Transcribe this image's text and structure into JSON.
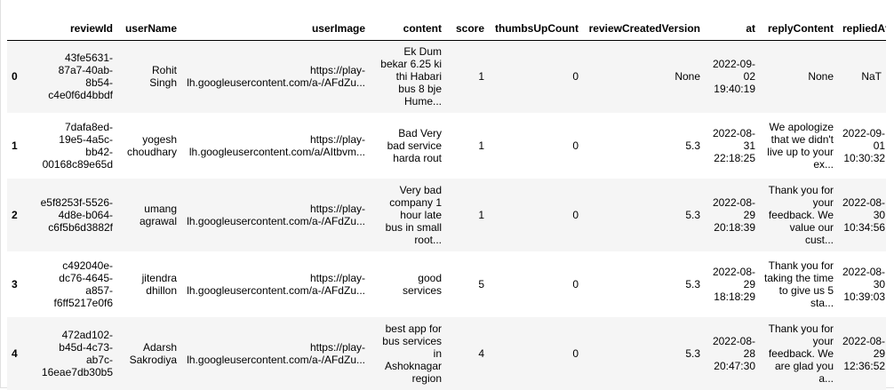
{
  "table": {
    "columns": [
      "",
      "reviewId",
      "userName",
      "userImage",
      "content",
      "score",
      "thumbsUpCount",
      "reviewCreatedVersion",
      "at",
      "replyContent",
      "repliedAt"
    ],
    "rows": [
      {
        "index": "0",
        "reviewId": [
          "43fe5631-",
          "87a7-40ab-",
          "8b54-",
          "c4e0f6d4bbdf"
        ],
        "userName": [
          "Rohit",
          "Singh"
        ],
        "userImage": [
          "https://play-",
          "lh.googleusercontent.com/a-/AFdZu..."
        ],
        "content": [
          "Ek Dum",
          "bekar 6.25 ki",
          "thi Habari",
          "bus 8 bje",
          "Hume..."
        ],
        "score": "1",
        "thumbsUpCount": "0",
        "reviewCreatedVersion": "None",
        "at": [
          "2022-09-",
          "02",
          "19:40:19"
        ],
        "replyContent": [
          "None"
        ],
        "repliedAt": [
          "NaT"
        ]
      },
      {
        "index": "1",
        "reviewId": [
          "7dafa8ed-",
          "19e5-4a5c-",
          "bb42-",
          "00168c89e65d"
        ],
        "userName": [
          "yogesh",
          "choudhary"
        ],
        "userImage": [
          "https://play-",
          "lh.googleusercontent.com/a/AItbvm..."
        ],
        "content": [
          "Bad Very",
          "bad service",
          "harda rout"
        ],
        "score": "1",
        "thumbsUpCount": "0",
        "reviewCreatedVersion": "5.3",
        "at": [
          "2022-08-",
          "31",
          "22:18:25"
        ],
        "replyContent": [
          "We apologize",
          "that we didn't",
          "live up to your",
          "ex..."
        ],
        "repliedAt": [
          "2022-09-",
          "01",
          "10:30:32"
        ]
      },
      {
        "index": "2",
        "reviewId": [
          "e5f8253f-5526-",
          "4d8e-b064-",
          "c6f5b6d3882f"
        ],
        "userName": [
          "umang",
          "agrawal"
        ],
        "userImage": [
          "https://play-",
          "lh.googleusercontent.com/a-/AFdZu..."
        ],
        "content": [
          "Very bad",
          "company 1",
          "hour late",
          "bus in small",
          "root..."
        ],
        "score": "1",
        "thumbsUpCount": "0",
        "reviewCreatedVersion": "5.3",
        "at": [
          "2022-08-",
          "29",
          "20:18:39"
        ],
        "replyContent": [
          "Thank you for",
          "your",
          "feedback. We",
          "value our",
          "cust..."
        ],
        "repliedAt": [
          "2022-08-",
          "30",
          "10:34:56"
        ]
      },
      {
        "index": "3",
        "reviewId": [
          "c492040e-",
          "dc76-4645-",
          "a857-",
          "f6ff5217e0f6"
        ],
        "userName": [
          "jitendra",
          "dhillon"
        ],
        "userImage": [
          "https://play-",
          "lh.googleusercontent.com/a-/AFdZu..."
        ],
        "content": [
          "good",
          "services"
        ],
        "score": "5",
        "thumbsUpCount": "0",
        "reviewCreatedVersion": "5.3",
        "at": [
          "2022-08-",
          "29",
          "18:18:29"
        ],
        "replyContent": [
          "Thank you for",
          "taking the time",
          "to give us 5",
          "sta..."
        ],
        "repliedAt": [
          "2022-08-",
          "30",
          "10:39:03"
        ]
      },
      {
        "index": "4",
        "reviewId": [
          "472ad102-",
          "b45d-4c73-",
          "ab7c-",
          "16eae7db30b5"
        ],
        "userName": [
          "Adarsh",
          "Sakrodiya"
        ],
        "userImage": [
          "https://play-",
          "lh.googleusercontent.com/a-/AFdZu..."
        ],
        "content": [
          "best app for",
          "bus services",
          "in",
          "Ashoknagar",
          "region"
        ],
        "score": "4",
        "thumbsUpCount": "0",
        "reviewCreatedVersion": "5.3",
        "at": [
          "2022-08-",
          "28",
          "20:47:30"
        ],
        "replyContent": [
          "Thank you for",
          "your",
          "feedback. We",
          "are glad you",
          "a..."
        ],
        "repliedAt": [
          "2022-08-",
          "29",
          "12:36:52"
        ]
      }
    ]
  }
}
